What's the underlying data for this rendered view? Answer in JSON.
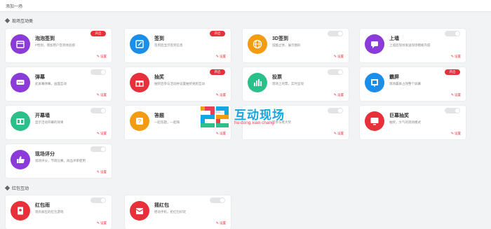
{
  "header": {
    "title": "添加一场"
  },
  "sections": [
    {
      "title": "现场互动类"
    },
    {
      "title": "红包互动"
    }
  ],
  "settings_label": "设置",
  "cards": [
    {
      "name": "泡泡签到",
      "desc": "P性别，增加用户签到体验感",
      "toggle": "开启",
      "on": true,
      "icon": "calendar-icon",
      "color": "#8a3bd8"
    },
    {
      "name": "签到",
      "desc": "签到后显示签到信息",
      "toggle": "开启",
      "on": true,
      "icon": "edit-icon",
      "color": "#1a8ee8"
    },
    {
      "name": "3D签到",
      "desc": "炫酷立体，展示图形",
      "toggle": "",
      "on": false,
      "icon": "globe-icon",
      "color": "#f39c12"
    },
    {
      "name": "上墙",
      "desc": "上墙后现场发送现场模板内容",
      "toggle": "",
      "on": false,
      "icon": "chat-icon",
      "color": "#8a3bd8"
    },
    {
      "name": "弹幕",
      "desc": "此屏幕弹幕，画面互动",
      "toggle": "",
      "on": false,
      "icon": "message-icon",
      "color": "#8a3bd8"
    },
    {
      "name": "抽奖",
      "desc": "抽奖后参与活动并设置抽奖规则互动",
      "toggle": "开启",
      "on": true,
      "icon": "gift-icon",
      "color": "#e8303b"
    },
    {
      "name": "投票",
      "desc": "现场上的票，实时呈现",
      "toggle": "",
      "on": false,
      "icon": "chart-icon",
      "color": "#2bbf8a"
    },
    {
      "name": "霸屏",
      "desc": "现场霸屏占领整个屏幕",
      "toggle": "开启",
      "on": true,
      "icon": "screen-icon",
      "color": "#1a8ee8"
    },
    {
      "name": "开幕墙",
      "desc": "显示活动开幕的效果",
      "toggle": "",
      "on": false,
      "icon": "curtain-icon",
      "color": "#2bbf8a"
    },
    {
      "name": "答题",
      "desc": "一起答题，一起嗨",
      "toggle": "",
      "on": false,
      "icon": "quiz-icon",
      "color": "#f39c12"
    },
    {
      "name": "",
      "desc": "可参与者大奖",
      "toggle": "",
      "on": false,
      "icon": "",
      "color": "#ffffff"
    },
    {
      "name": "巨幕抽奖",
      "desc": "抽奖，大气的现场模式",
      "toggle": "",
      "on": false,
      "icon": "monitor-icon",
      "color": "#e8303b"
    },
    {
      "name": "现场评分",
      "desc": "现场评分，节目比赛，商品评审使用",
      "toggle": "",
      "on": false,
      "icon": "thumb-icon",
      "color": "#8a3bd8"
    },
    {
      "name": "红包雨",
      "desc": "现有疯狂的红包游戏",
      "toggle": "",
      "on": false,
      "icon": "redpacket-icon",
      "color": "#e8303b"
    },
    {
      "name": "摇红包",
      "desc": "摇动手机，抢红包好玩",
      "toggle": "",
      "on": false,
      "icon": "envelope-icon",
      "color": "#e8303b"
    }
  ],
  "watermark": {
    "title": "互动现场",
    "subtitle": "hu dong xian chang"
  }
}
